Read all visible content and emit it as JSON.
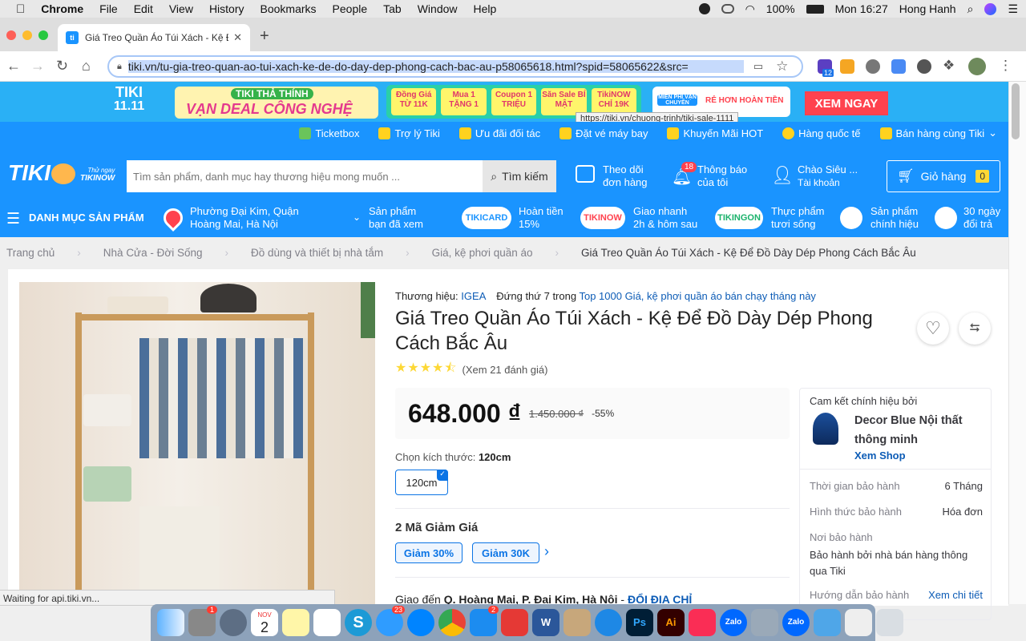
{
  "macos": {
    "apple": "",
    "app": "Chrome",
    "menus": [
      "File",
      "Edit",
      "View",
      "History",
      "Bookmarks",
      "People",
      "Tab",
      "Window",
      "Help"
    ],
    "battery": "100%",
    "clock": "Mon 16:27",
    "user": "Hong Hanh"
  },
  "browser": {
    "tab_title": "Giá Treo Quần Áo Túi Xách - Kệ Để",
    "favicon": "tiki",
    "url": "tiki.vn/tu-gia-treo-quan-ao-tui-xach-ke-de-do-day-dep-phong-cach-bac-au-p58065618.html?spid=58065622&src=",
    "ext_badge": "12",
    "status": "Waiting for api.tiki.vn...",
    "tooltip": "https://tiki.vn/chuong-trinh/tiki-sale-1111"
  },
  "promo": {
    "logo_line1": "TIKI",
    "logo_line2": "11.11",
    "tagline": "TIKI THẢ THÍNH",
    "headline": "VẠN DEAL CÔNG NGHỆ",
    "chips": [
      "Đồng Giá TỪ 11K",
      "Mua 1 TẶNG 1",
      "Coupon 1 TRIỆU",
      "Săn Sale BÍ MẬT",
      "TikiNOW CHỈ 19K"
    ],
    "freeship": "MIỄN PHÍ VẬN CHUYỂN",
    "cheaper": "RẺ HƠN HOÀN TIỀN",
    "cta": "XEM NGAY"
  },
  "toplinks": [
    "Ticketbox",
    "Trợ lý Tiki",
    "Ưu đãi đối tác",
    "Đặt vé máy bay",
    "Khuyến Mãi HOT",
    "Hàng quốc tế",
    "Bán hàng cùng Tiki"
  ],
  "header": {
    "logo": "TIKI",
    "logo_sub1": "Thử ngay",
    "logo_sub2": "TIKINOW",
    "search_placeholder": "Tìm sản phẩm, danh mục hay thương hiệu mong muốn ...",
    "search_btn": "Tìm kiếm",
    "track1": "Theo dõi",
    "track2": "đơn hàng",
    "notif_count": "18",
    "notif1": "Thông báo",
    "notif2": "của tôi",
    "acct1": "Chào Siêu ...",
    "acct2": "Tài khoản",
    "cart": "Giỏ hàng",
    "cart_count": "0",
    "menu": "DANH MỤC SẢN PHẨM",
    "loc1": "Phường Đại Kim, Quận",
    "loc2": "Hoàng Mai, Hà Nội",
    "viewed1": "Sản phẩm",
    "viewed2": "bạn đã xem",
    "tikicard": "TIKICARD",
    "cb1": "Hoàn tiền",
    "cb2": "15%",
    "tikinow": "TIKINOW",
    "fast1": "Giao nhanh",
    "fast2": "2h & hôm sau",
    "tikingon": "TIKINGON",
    "fresh1": "Thực phẩm",
    "fresh2": "tươi sống",
    "genuine1": "Sản phẩm",
    "genuine2": "chính hiệu",
    "ret1": "30 ngày",
    "ret2": "đổi trả"
  },
  "breadcrumb": [
    "Trang chủ",
    "Nhà Cửa - Đời Sống",
    "Đồ dùng và thiết bị nhà tắm",
    "Giá, kệ phơi quần áo",
    "Giá Treo Quần Áo Túi Xách - Kệ Để Đồ Dày Dép Phong Cách Bắc Âu"
  ],
  "product": {
    "brand_label": "Thương hiệu:",
    "brand": "IGEA",
    "rank_label": "Đứng thứ 7 trong",
    "rank_link": "Top 1000 Giá, kệ phơi quần áo bán chạy tháng này",
    "title": "Giá Treo Quần Áo Túi Xách - Kệ Để Đồ Dày Dép Phong Cách Bắc Âu",
    "rating": 4.5,
    "reviews": "(Xem 21 đánh giá)",
    "price": "648.000 ₫",
    "old_price": "1.450.000 ₫",
    "discount": "-55%",
    "size_label": "Chọn kích thước:",
    "size_value": "120cm",
    "size_option": "120cm",
    "coupon_title": "2 Mã Giảm Giá",
    "coupons": [
      "Giảm 30%",
      "Giảm 30K"
    ],
    "ship_label": "Giao đến",
    "ship_addr": "Q. Hoàng Mai, P. Đại Kim, Hà Nội",
    "ship_sep": "-",
    "ship_change": "ĐỔI ĐỊA CHỈ"
  },
  "seller": {
    "commit": "Cam kết chính hiệu bởi",
    "name1": "Decor Blue Nội thất",
    "name2": "thông minh",
    "shop": "Xem Shop",
    "w_time_l": "Thời gian bảo hành",
    "w_time": "6 Tháng",
    "w_form_l": "Hình thức bảo hành",
    "w_form": "Hóa đơn",
    "w_place_l": "Nơi bảo hành",
    "w_place": "Bảo hành bởi nhà bán hàng thông qua Tiki",
    "w_guide_l": "Hướng dẫn bảo hành",
    "w_guide": "Xem chi tiết"
  },
  "dock": {
    "calendar_month": "NOV",
    "calendar_day": "2",
    "badge1": "1",
    "badge2": "23",
    "badge3": "2",
    "zalo": "Zalo"
  },
  "colors": {
    "tiki_blue": "#1a94ff",
    "accent_red": "#ff424e",
    "star": "#fdd836"
  }
}
